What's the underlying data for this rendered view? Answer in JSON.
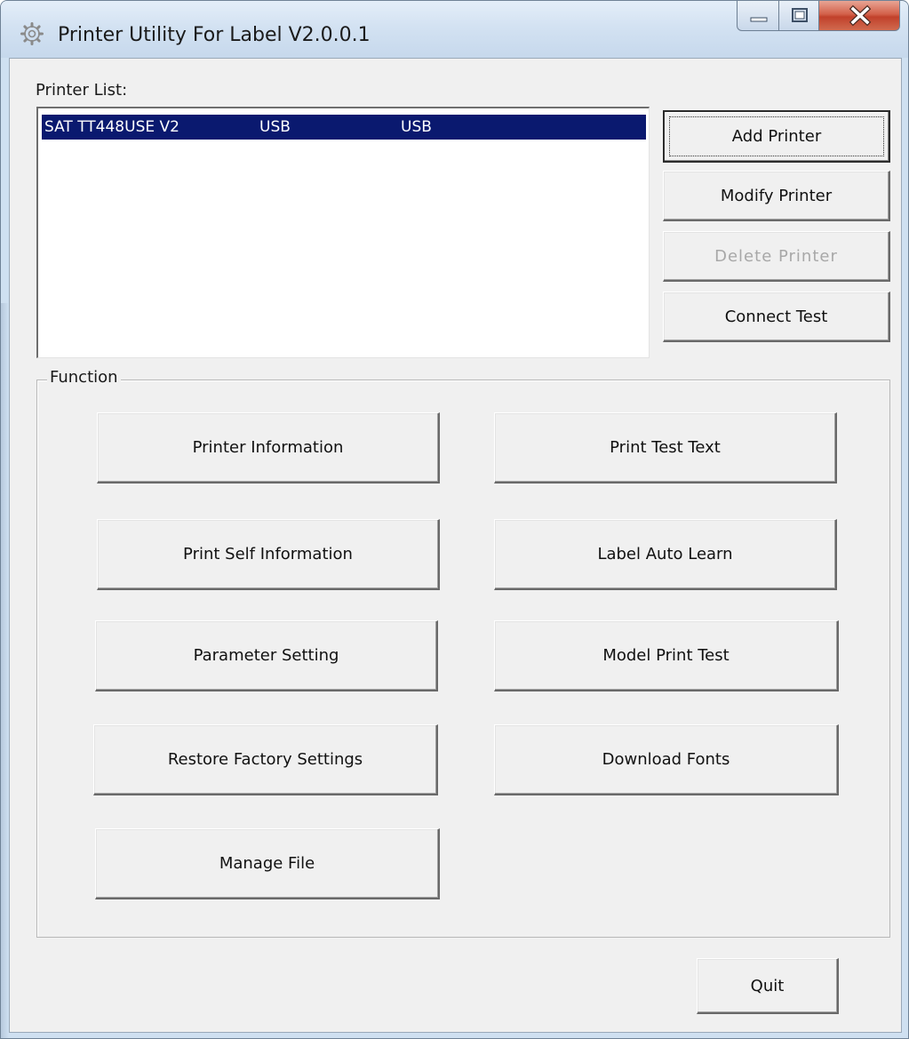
{
  "window": {
    "title": "Printer Utility For Label  V2.0.0.1",
    "app_icon": "gear-icon",
    "caption_buttons": [
      "minimize-icon",
      "maximize-icon",
      "close-icon"
    ]
  },
  "printer_list": {
    "label": "Printer List:",
    "rows": [
      {
        "name": "SAT TT448USE V2",
        "port": "USB",
        "type": "USB",
        "selected": true
      }
    ],
    "buttons": {
      "add": "Add Printer",
      "modify": "Modify Printer",
      "delete": "Delete Printer",
      "connect_test": "Connect Test"
    }
  },
  "function": {
    "title": "Function",
    "buttons": {
      "printer_information": "Printer Information",
      "print_test_text": "Print Test Text",
      "print_self_information": "Print Self Information",
      "label_auto_learn": "Label Auto Learn",
      "parameter_setting": "Parameter Setting",
      "model_print_test": "Model Print Test",
      "restore_factory_settings": "Restore Factory Settings",
      "download_fonts": "Download Fonts",
      "manage_file": "Manage File"
    }
  },
  "footer": {
    "quit": "Quit"
  },
  "colors": {
    "selection": "#0a196f",
    "dialog_bg": "#f0f0f0",
    "close_button": "#c1412b"
  }
}
